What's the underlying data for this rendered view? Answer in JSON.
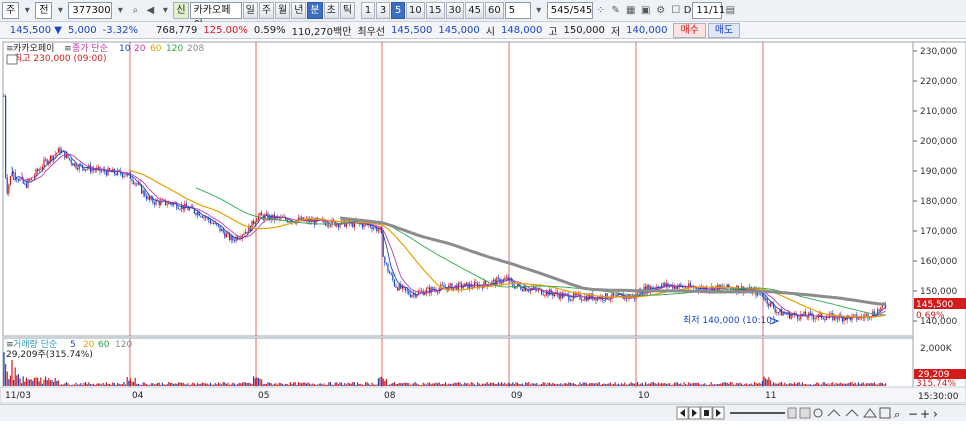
{
  "toolbar": {
    "market_label": "주",
    "jeon_label": "전",
    "code": "377300",
    "sin_label": "신",
    "stock_name": "카카오페이",
    "periods": [
      "일",
      "주",
      "월",
      "년",
      "분",
      "초",
      "틱"
    ],
    "active_period": "분",
    "intervals": [
      "1",
      "3",
      "5",
      "10",
      "15",
      "30",
      "45",
      "60"
    ],
    "active_interval": "5",
    "interval_value": "5",
    "count": "545/545",
    "d_label": "D",
    "date": "11/11"
  },
  "quote": {
    "price": "145,500",
    "change": "5,000",
    "change_pct": "-3.32%",
    "volume": "768,779",
    "vol_ratio": "125.00%",
    "turnover_pct": "0.59%",
    "amount": "110,270백만",
    "best_label": "최우선",
    "ask": "145,500",
    "bid": "145,000",
    "open_label": "시",
    "open": "148,000",
    "high_label": "고",
    "high": "150,000",
    "low_label": "저",
    "low": "140,000",
    "buy_label": "매수",
    "sell_label": "매도"
  },
  "price_panel": {
    "name": "카카오페이",
    "ma_title": "종가 단순",
    "ma_periods": [
      "10",
      "20",
      "60",
      "120",
      "208"
    ],
    "high_note": "최고 230,000 (09:00)",
    "low_note": "최저 140,000 (10:10)",
    "last_price": "145,500",
    "last_pct": "0.69%",
    "y_ticks": [
      "230,000",
      "220,000",
      "210,000",
      "200,000",
      "190,000",
      "180,000",
      "170,000",
      "160,000",
      "150,000",
      "140,000"
    ]
  },
  "volume_panel": {
    "title": "거래량 단순",
    "ma_periods": [
      "5",
      "20",
      "60",
      "120"
    ],
    "value_note": "29,209주(315.74%)",
    "axis_label": "2,000K",
    "last_value": "29,209",
    "last_pct": "315.74%"
  },
  "x_axis": {
    "labels": [
      "11/03",
      "04",
      "05",
      "08",
      "09",
      "10",
      "11"
    ],
    "time": "15:30:00"
  },
  "colors": {
    "up": "#d21c1c",
    "down": "#1a45c8",
    "ma10": "#1a45c8",
    "ma20": "#c03aa0",
    "ma60": "#e8a000",
    "ma120": "#2aa84a",
    "ma208": "#8c8c8c",
    "session_line": "#d94848"
  },
  "chart_data": {
    "type": "line",
    "title": "",
    "x": [
      "11/03",
      "04",
      "05",
      "08",
      "09",
      "10",
      "11"
    ],
    "ylim": [
      135000,
      233000
    ],
    "series": [
      {
        "name": "카카오페이",
        "values": [
          188000,
          181000,
          172000,
          145000,
          148000,
          149000,
          145500
        ]
      },
      {
        "name": "208",
        "values": [
          null,
          null,
          180000,
          168000,
          160000,
          153000,
          147000
        ]
      }
    ]
  }
}
